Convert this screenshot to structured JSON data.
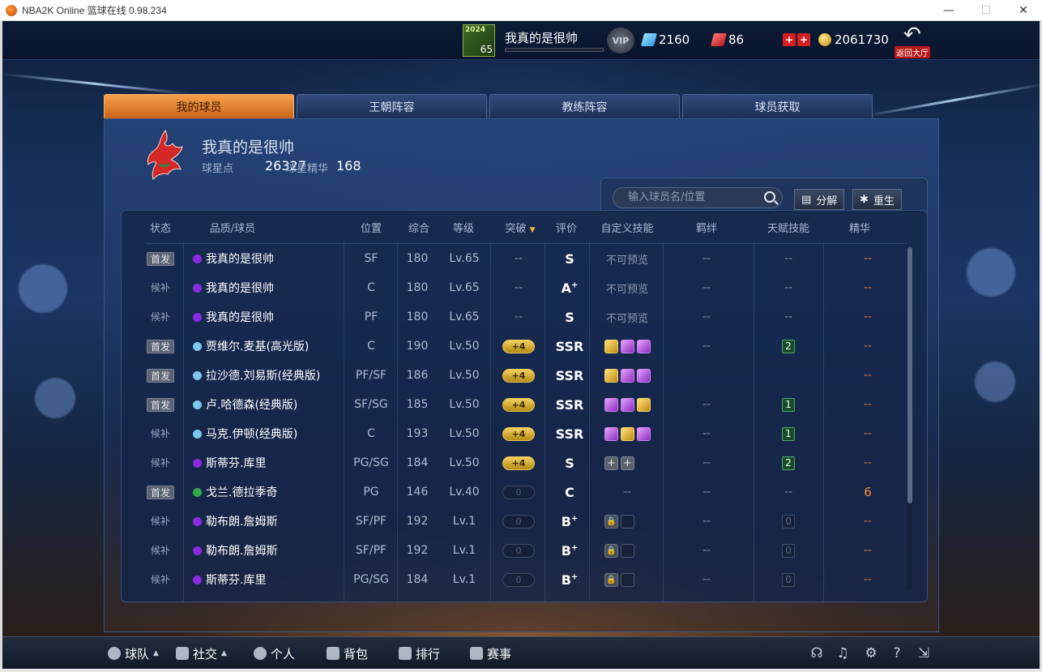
{
  "window": {
    "title": "NBA2K Online 篮球在线 0.98.234",
    "controls": [
      "—",
      "☐",
      "✕"
    ]
  },
  "topbar": {
    "card_year": "2024",
    "card_number": "65",
    "player_name": "我真的是很帅",
    "vip_label": "VIP",
    "diamonds": "2160",
    "tickets": "86",
    "coins": "2061730",
    "back_label": "返回大厅"
  },
  "tabs": [
    {
      "label": "我的球员",
      "active": true
    },
    {
      "label": "王朝阵容",
      "active": false
    },
    {
      "label": "教练阵容",
      "active": false
    },
    {
      "label": "球员获取",
      "active": false
    }
  ],
  "team": {
    "name": "我真的是很帅",
    "star_points_label": "球星点",
    "star_points": "26327",
    "star_essence_label": "球星精华",
    "star_essence": "168"
  },
  "tools": {
    "search_placeholder": "输入球员名/位置",
    "decompose_label": "分解",
    "rebirth_label": "重生"
  },
  "table": {
    "headers": [
      "状态",
      "品质/球员",
      "位置",
      "综合",
      "等级",
      "突破",
      "评价",
      "自定义技能",
      "羁绊",
      "天赋技能",
      "精华"
    ],
    "rows": [
      {
        "status": "首发",
        "starter": true,
        "quality": "purple",
        "name": "我真的是很帅",
        "pos": "SF",
        "ovr": "180",
        "level": "Lv.65",
        "breakthrough": "--",
        "bt_type": "none",
        "rating": "S",
        "rating_sup": "",
        "skills_type": "text",
        "skills_text": "不可预览",
        "skills": [],
        "bond": "--",
        "talent": "--",
        "talent_type": "none",
        "essence": "--"
      },
      {
        "status": "候补",
        "starter": false,
        "quality": "purple",
        "name": "我真的是很帅",
        "pos": "C",
        "ovr": "180",
        "level": "Lv.65",
        "breakthrough": "--",
        "bt_type": "none",
        "rating": "A",
        "rating_sup": "+",
        "skills_type": "text",
        "skills_text": "不可预览",
        "skills": [],
        "bond": "--",
        "talent": "--",
        "talent_type": "none",
        "essence": "--"
      },
      {
        "status": "候补",
        "starter": false,
        "quality": "purple",
        "name": "我真的是很帅",
        "pos": "PF",
        "ovr": "180",
        "level": "Lv.65",
        "breakthrough": "--",
        "bt_type": "none",
        "rating": "S",
        "rating_sup": "",
        "skills_type": "text",
        "skills_text": "不可预览",
        "skills": [],
        "bond": "--",
        "talent": "--",
        "talent_type": "none",
        "essence": "--"
      },
      {
        "status": "首发",
        "starter": true,
        "quality": "lightblue",
        "name": "贾维尔.麦基(高光版)",
        "pos": "C",
        "ovr": "190",
        "level": "Lv.50",
        "breakthrough": "+4",
        "bt_type": "on",
        "rating": "SSR",
        "rating_sup": "",
        "skills_type": "icons",
        "skills_text": "",
        "skills": [
          "gold",
          "purple",
          "purple"
        ],
        "bond": "--",
        "talent": "2",
        "talent_type": "on",
        "essence": "--"
      },
      {
        "status": "首发",
        "starter": true,
        "quality": "lightblue",
        "name": "拉沙德.刘易斯(经典版)",
        "pos": "PF/SF",
        "ovr": "186",
        "level": "Lv.50",
        "breakthrough": "+4",
        "bt_type": "on",
        "rating": "SSR",
        "rating_sup": "",
        "skills_type": "icons",
        "skills_text": "",
        "skills": [
          "gold",
          "purple",
          "purple"
        ],
        "bond": "",
        "talent": "",
        "talent_type": "none",
        "essence": "--"
      },
      {
        "status": "首发",
        "starter": true,
        "quality": "lightblue",
        "name": "卢.哈德森(经典版)",
        "pos": "SF/SG",
        "ovr": "185",
        "level": "Lv.50",
        "breakthrough": "+4",
        "bt_type": "on",
        "rating": "SSR",
        "rating_sup": "",
        "skills_type": "icons",
        "skills_text": "",
        "skills": [
          "purple",
          "purple",
          "gold"
        ],
        "bond": "--",
        "talent": "1",
        "talent_type": "on",
        "essence": "--"
      },
      {
        "status": "候补",
        "starter": false,
        "quality": "lightblue",
        "name": "马克.伊顿(经典版)",
        "pos": "C",
        "ovr": "193",
        "level": "Lv.50",
        "breakthrough": "+4",
        "bt_type": "on",
        "rating": "SSR",
        "rating_sup": "",
        "skills_type": "icons",
        "skills_text": "",
        "skills": [
          "purple",
          "gold",
          "purple"
        ],
        "bond": "--",
        "talent": "1",
        "talent_type": "on",
        "essence": "--"
      },
      {
        "status": "候补",
        "starter": false,
        "quality": "purple",
        "name": "斯蒂芬.库里",
        "pos": "PG/SG",
        "ovr": "184",
        "level": "Lv.50",
        "breakthrough": "+4",
        "bt_type": "on",
        "rating": "S",
        "rating_sup": "",
        "skills_type": "icons",
        "skills_text": "",
        "skills": [
          "plus",
          "plus"
        ],
        "bond": "--",
        "talent": "2",
        "talent_type": "on",
        "essence": "--"
      },
      {
        "status": "首发",
        "starter": true,
        "quality": "green",
        "name": "戈兰.德拉季奇",
        "pos": "PG",
        "ovr": "146",
        "level": "Lv.40",
        "breakthrough": "0",
        "bt_type": "off",
        "rating": "C",
        "rating_sup": "",
        "skills_type": "text",
        "skills_text": "--",
        "skills": [],
        "bond": "--",
        "talent": "--",
        "talent_type": "none",
        "essence": "6"
      },
      {
        "status": "候补",
        "starter": false,
        "quality": "purple",
        "name": "勒布朗.詹姆斯",
        "pos": "SF/PF",
        "ovr": "192",
        "level": "Lv.1",
        "breakthrough": "0",
        "bt_type": "off",
        "rating": "B",
        "rating_sup": "+",
        "skills_type": "icons",
        "skills_text": "",
        "skills": [
          "lock",
          "empty"
        ],
        "bond": "--",
        "talent": "0",
        "talent_type": "off",
        "essence": "--"
      },
      {
        "status": "候补",
        "starter": false,
        "quality": "purple",
        "name": "勒布朗.詹姆斯",
        "pos": "SF/PF",
        "ovr": "192",
        "level": "Lv.1",
        "breakthrough": "0",
        "bt_type": "off",
        "rating": "B",
        "rating_sup": "+",
        "skills_type": "icons",
        "skills_text": "",
        "skills": [
          "lock",
          "empty"
        ],
        "bond": "--",
        "talent": "0",
        "talent_type": "off",
        "essence": "--"
      },
      {
        "status": "候补",
        "starter": false,
        "quality": "purple",
        "name": "斯蒂芬.库里",
        "pos": "PG/SG",
        "ovr": "184",
        "level": "Lv.1",
        "breakthrough": "0",
        "bt_type": "off",
        "rating": "B",
        "rating_sup": "+",
        "skills_type": "icons",
        "skills_text": "",
        "skills": [
          "lock",
          "empty"
        ],
        "bond": "--",
        "talent": "0",
        "talent_type": "off",
        "essence": "--"
      }
    ]
  },
  "bottom_nav": [
    {
      "label": "球队",
      "icon": "person-icon",
      "has_caret": true
    },
    {
      "label": "社交",
      "icon": "handshake-icon",
      "has_caret": true
    },
    {
      "label": "个人",
      "icon": "user-icon",
      "has_caret": false
    },
    {
      "label": "背包",
      "icon": "backpack-icon",
      "has_caret": false
    },
    {
      "label": "排行",
      "icon": "ranking-icon",
      "has_caret": false
    },
    {
      "label": "赛事",
      "icon": "trophy-icon",
      "has_caret": false
    }
  ],
  "utility_icons": [
    "headset-icon",
    "music-icon",
    "settings-icon",
    "help-icon",
    "exit-icon"
  ],
  "colors": {
    "quality_purple": "#8a2be2",
    "quality_lightblue": "#7ec8f0",
    "quality_green": "#2fa84a",
    "active_tab": "#e07a2a",
    "essence_orange": "#f08a3c"
  }
}
